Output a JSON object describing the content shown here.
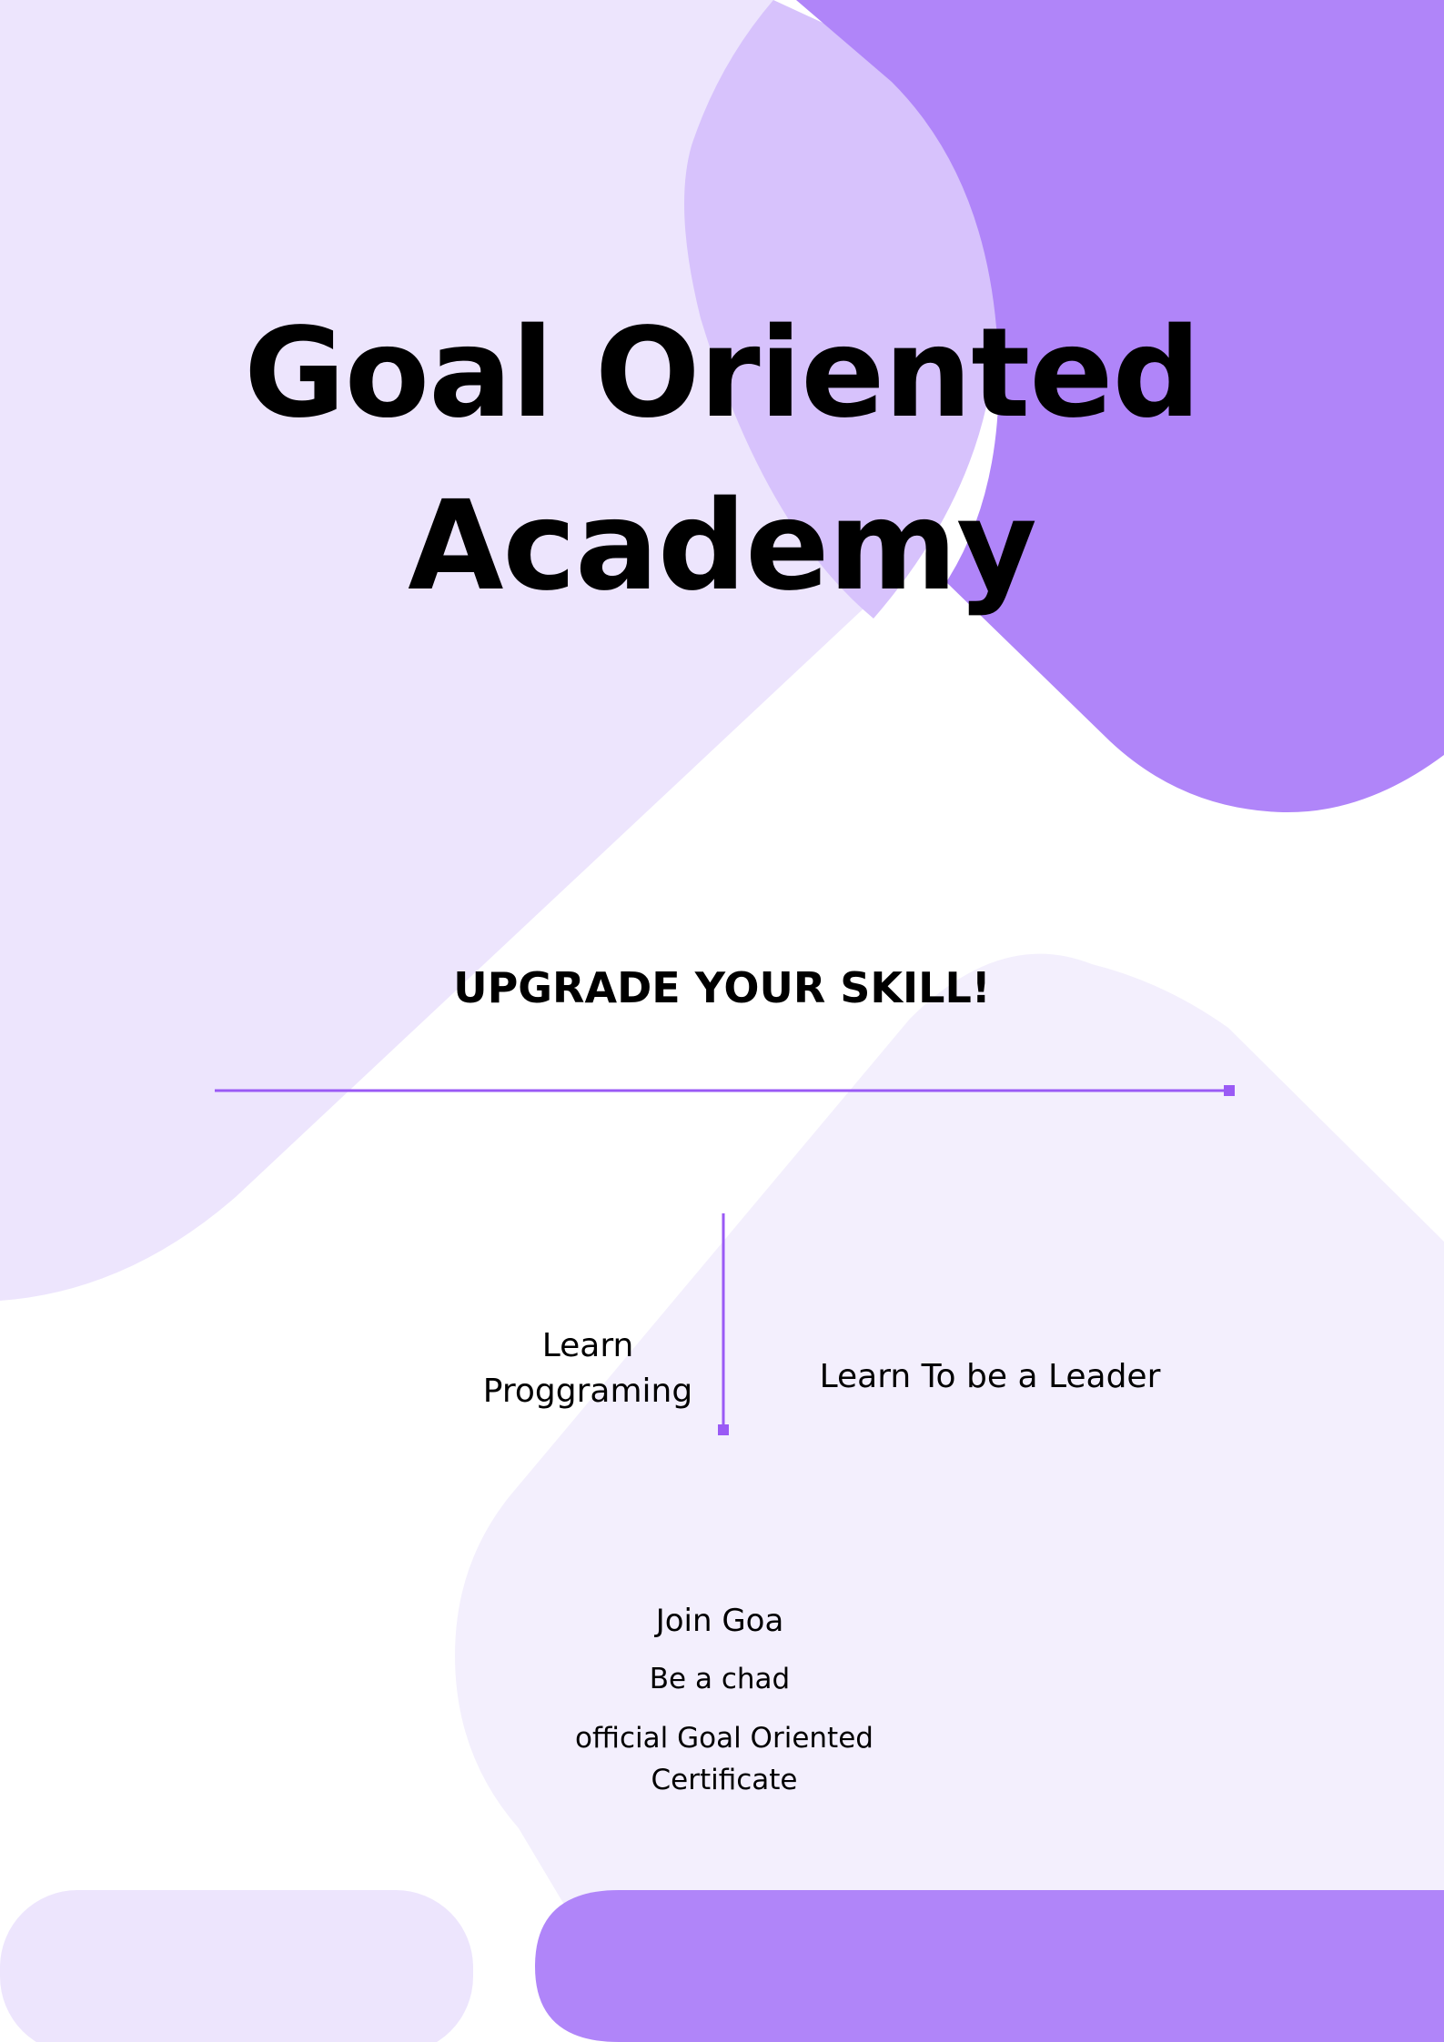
{
  "poster": {
    "title_line1": "Goal Oriented",
    "title_line2": "Academy",
    "tagline": "UPGRADE  YOUR SKILL!",
    "left_offering_line1": "Learn",
    "left_offering_line2": "Proggraming",
    "right_offering": "Learn To be a Leader",
    "join_text": "Join Goa",
    "chad_text": "Be a chad",
    "certificate_text": "official Goal Oriented Certificate"
  },
  "colors": {
    "background": "#ffffff",
    "light_lavender": "#ede5fd",
    "pale_lavender": "#f3effd",
    "mid_lavender": "#d7c2fc",
    "accent_purple": "#b085f9",
    "line_purple": "#9a5af5",
    "text": "#000000"
  }
}
